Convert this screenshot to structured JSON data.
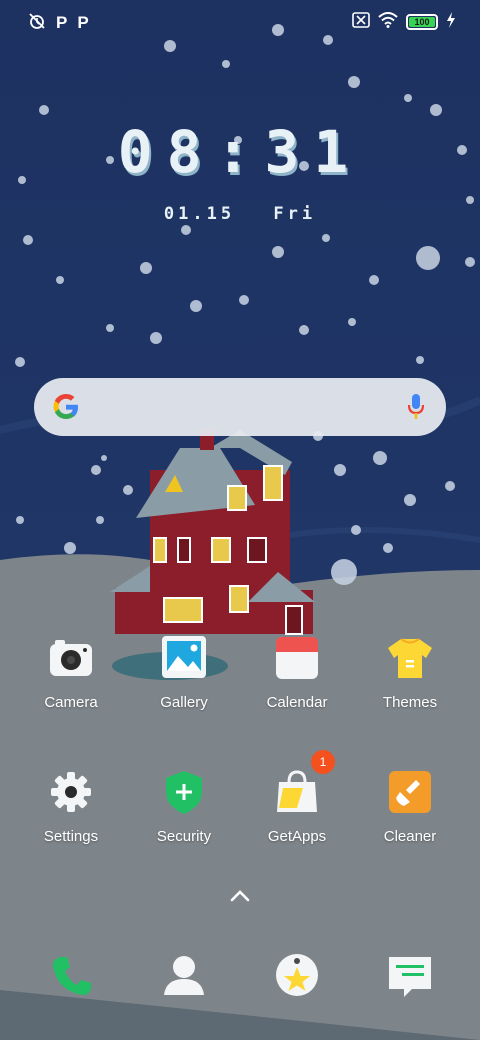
{
  "status_bar": {
    "left_icons": [
      "alarm-off-icon",
      "p-icon",
      "p-icon"
    ],
    "p_label_1": "P",
    "p_label_2": "P",
    "right_icons": [
      "sim-off-icon",
      "wifi-icon",
      "battery-icon",
      "charging-icon"
    ],
    "battery_level": "100"
  },
  "clock": {
    "time": "08:31",
    "date": "01.15",
    "weekday": "Fri"
  },
  "search_bar": {
    "logo": "google-icon",
    "mic_icon": "mic-icon"
  },
  "apps_row1": [
    {
      "label": "Camera",
      "icon": "camera-icon"
    },
    {
      "label": "Gallery",
      "icon": "gallery-icon"
    },
    {
      "label": "Calendar",
      "icon": "calendar-icon"
    },
    {
      "label": "Themes",
      "icon": "themes-icon"
    }
  ],
  "apps_row2": [
    {
      "label": "Settings",
      "icon": "gear-icon"
    },
    {
      "label": "Security",
      "icon": "shield-icon"
    },
    {
      "label": "GetApps",
      "icon": "shopping-bag-icon",
      "badge": "1"
    },
    {
      "label": "Cleaner",
      "icon": "brush-icon"
    }
  ],
  "app_drawer_icon": "chevron-up-icon",
  "dock": [
    {
      "icon": "phone-icon"
    },
    {
      "icon": "contacts-icon"
    },
    {
      "icon": "star-app-icon"
    },
    {
      "icon": "messages-icon"
    }
  ],
  "colors": {
    "sky": "#1f3566",
    "snow_ground": "#7e858a",
    "house_red": "#8b1e2a",
    "battery_green": "#39d353",
    "badge": "#f4511e"
  }
}
